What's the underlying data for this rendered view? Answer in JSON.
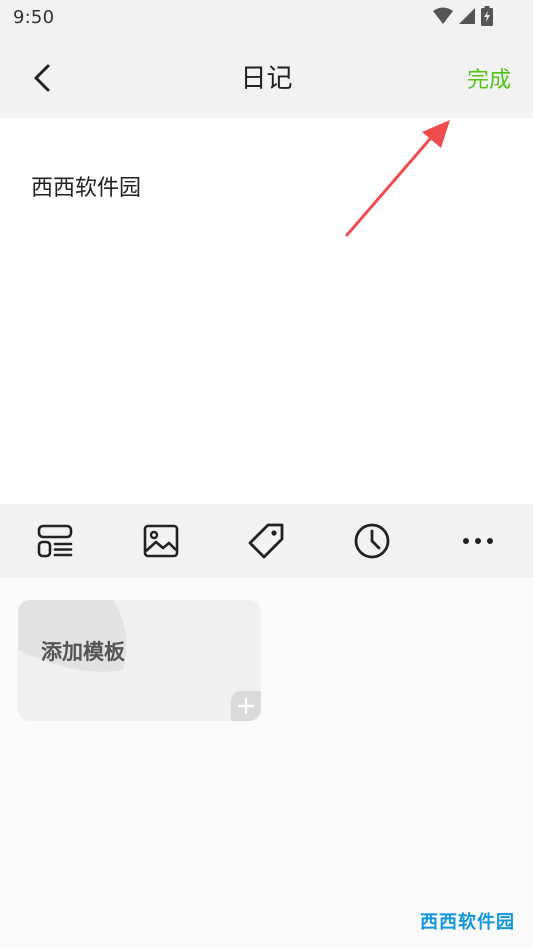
{
  "status_bar": {
    "time": "9:50",
    "icons": [
      "wifi-icon",
      "signal-icon",
      "battery-charging-icon"
    ]
  },
  "header": {
    "back_icon": "chevron-left-icon",
    "title": "日记",
    "done_label": "完成",
    "accent_color": "#52c41a"
  },
  "editor": {
    "content": "西西软件园",
    "annotation_arrow_color": "#ef4d4d"
  },
  "toolbar": {
    "items": [
      {
        "name": "template-tool",
        "icon": "template-list-icon"
      },
      {
        "name": "image-tool",
        "icon": "image-icon"
      },
      {
        "name": "tag-tool",
        "icon": "tag-icon"
      },
      {
        "name": "time-tool",
        "icon": "clock-icon"
      },
      {
        "name": "more-tool",
        "icon": "more-horizontal-icon"
      }
    ]
  },
  "templates": {
    "add_label": "添加模板",
    "add_icon": "plus-icon"
  },
  "watermark": {
    "text": "西西软件园",
    "color": "#1296db"
  }
}
